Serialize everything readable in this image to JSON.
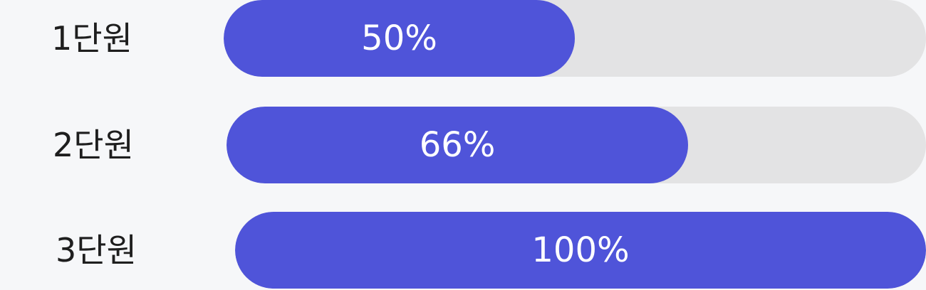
{
  "colors": {
    "background": "#f6f7f9",
    "track": "#e3e3e4",
    "fill": "#4f54d9",
    "label_text": "#1e1e1e",
    "fill_text": "#ffffff"
  },
  "progress": [
    {
      "unit": "1단원",
      "value": 0.5,
      "label": "50%"
    },
    {
      "unit": "2단원",
      "value": 0.66,
      "label": "66%"
    },
    {
      "unit": "3단원",
      "value": 1.0,
      "label": "100%"
    }
  ]
}
